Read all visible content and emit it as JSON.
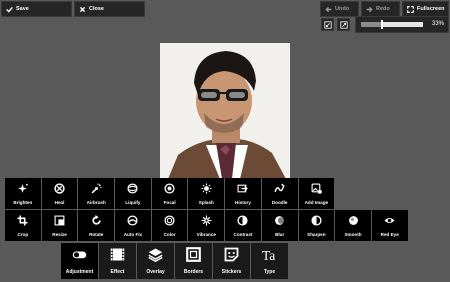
{
  "toolbar": {
    "save_label": "Save",
    "close_label": "Close",
    "undo_label": "Undo",
    "redo_label": "Redo",
    "fullscreen_label": "Fullscreen",
    "zoom_value": "33%",
    "zoom_fraction": 0.33
  },
  "tools_row1": [
    {
      "label": "Brighten",
      "icon": "sparkle-icon"
    },
    {
      "label": "Heal",
      "icon": "bandage-icon"
    },
    {
      "label": "Airbrush",
      "icon": "airbrush-icon"
    },
    {
      "label": "Liquify",
      "icon": "liquify-icon"
    },
    {
      "label": "Focal",
      "icon": "focal-icon"
    },
    {
      "label": "Splash",
      "icon": "splash-icon"
    },
    {
      "label": "History",
      "icon": "history-icon"
    },
    {
      "label": "Doodle",
      "icon": "doodle-icon"
    },
    {
      "label": "Add Image",
      "icon": "add-image-icon"
    }
  ],
  "tools_row2": [
    {
      "label": "Crop",
      "icon": "crop-icon"
    },
    {
      "label": "Resize",
      "icon": "resize-icon"
    },
    {
      "label": "Rotate",
      "icon": "rotate-icon"
    },
    {
      "label": "Auto Fix",
      "icon": "auto-fix-icon"
    },
    {
      "label": "Color",
      "icon": "color-icon"
    },
    {
      "label": "Vibrance",
      "icon": "vibrance-icon"
    },
    {
      "label": "Contrast",
      "icon": "contrast-icon"
    },
    {
      "label": "Blur",
      "icon": "blur-icon"
    },
    {
      "label": "Sharpen",
      "icon": "sharpen-icon"
    },
    {
      "label": "Smooth",
      "icon": "smooth-icon"
    },
    {
      "label": "Red Eye",
      "icon": "eye-icon"
    }
  ],
  "categories": [
    {
      "label": "Adjustment",
      "icon": "toggle-icon"
    },
    {
      "label": "Effect",
      "icon": "film-icon"
    },
    {
      "label": "Overlay",
      "icon": "layers-icon"
    },
    {
      "label": "Borders",
      "icon": "border-icon"
    },
    {
      "label": "Stickers",
      "icon": "sticker-icon"
    },
    {
      "label": "Type",
      "icon": "type-icon"
    }
  ]
}
